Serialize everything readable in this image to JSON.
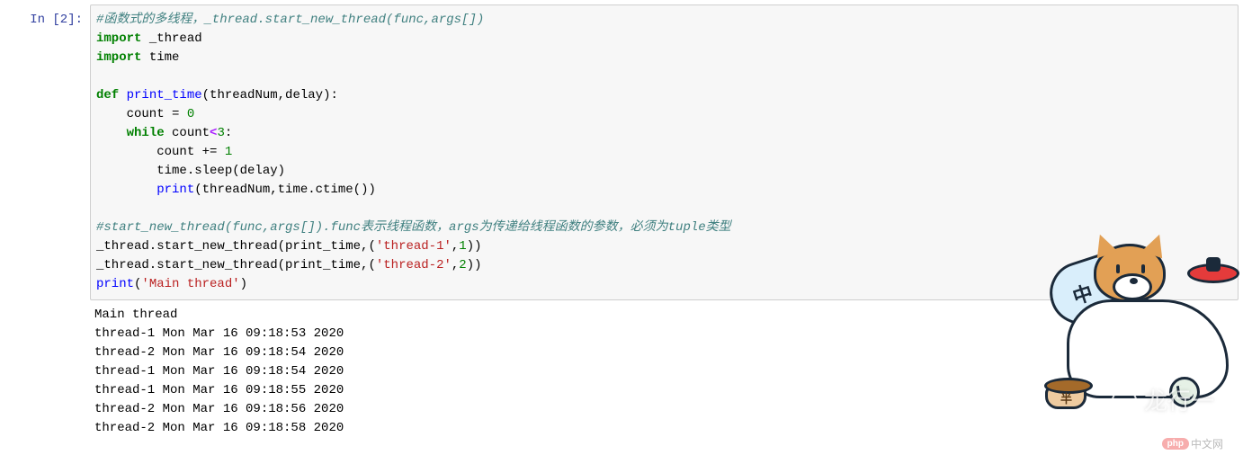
{
  "prompt": "In [2]:",
  "code": {
    "t1": "#函数式的多线程，_thread.start_new_thread(func,args[])",
    "t2a": "import",
    "t2b": " _thread",
    "t3a": "import",
    "t3b": " time",
    "t4": "",
    "t5a": "def",
    "t5b": " ",
    "t5c": "print_time",
    "t5d": "(threadNum,delay):",
    "t6a": "    count = ",
    "t6b": "0",
    "t7a": "    ",
    "t7b": "while",
    "t7c": " count",
    "t7d": "<",
    "t7e": "3",
    "t7f": ":",
    "t8a": "        count += ",
    "t8b": "1",
    "t9": "        time.sleep(delay)",
    "t10a": "        ",
    "t10b": "print",
    "t10c": "(threadNum,time.ctime())",
    "t11": "",
    "t12": "#start_new_thread(func,args[]).func表示线程函数，args为传递给线程函数的参数，必须为tuple类型",
    "t13a": "_thread.start_new_thread(print_time,(",
    "t13b": "'thread-1'",
    "t13c": ",",
    "t13d": "1",
    "t13e": "))",
    "t14a": "_thread.start_new_thread(print_time,(",
    "t14b": "'thread-2'",
    "t14c": ",",
    "t14d": "2",
    "t14e": "))",
    "t15a": "print",
    "t15b": "(",
    "t15c": "'Main thread'",
    "t15d": ")"
  },
  "output": {
    "l0": "Main thread",
    "l1": "thread-1 Mon Mar 16 09:18:53 2020",
    "l2": "thread-2 Mon Mar 16 09:18:54 2020",
    "l3": "thread-1 Mon Mar 16 09:18:54 2020",
    "l4": "thread-1 Mon Mar 16 09:18:55 2020",
    "l5": "thread-2 Mon Mar 16 09:18:56 2020",
    "l6": "thread-2 Mon Mar 16 09:18:58 2020"
  },
  "mascot": {
    "pillow": "中",
    "bowl": "半"
  },
  "watermark": "龙行一",
  "badge": {
    "pill": "php",
    "text": "中文网"
  }
}
